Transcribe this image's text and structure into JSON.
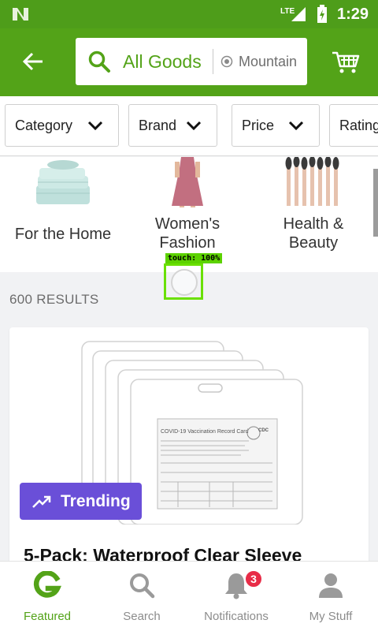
{
  "status_bar": {
    "network": "LTE",
    "time": "1:29"
  },
  "app_bar": {
    "search_query": "All Goods",
    "location": "Mountain"
  },
  "filters": [
    {
      "label": "Category"
    },
    {
      "label": "Brand"
    },
    {
      "label": "Price"
    },
    {
      "label": "Rating"
    }
  ],
  "categories": [
    {
      "label_line1": "For the Home",
      "label_line2": ""
    },
    {
      "label_line1": "Women's",
      "label_line2": "Fashion"
    },
    {
      "label_line1": "Health &",
      "label_line2": "Beauty"
    }
  ],
  "touch_overlay": {
    "label": "touch: 100%"
  },
  "results": {
    "count_text": "600 RESULTS"
  },
  "product": {
    "badge": "Trending",
    "title": "5-Pack: Waterproof Clear Sleeve",
    "image_card_title": "COVID-19 Vaccination Record Card",
    "image_card_logo": "CDC"
  },
  "bottom_nav": [
    {
      "label": "Featured",
      "icon": "featured-g-icon",
      "active": true
    },
    {
      "label": "Search",
      "icon": "search-icon"
    },
    {
      "label": "Notifications",
      "icon": "bell-icon",
      "badge": "3"
    },
    {
      "label": "My Stuff",
      "icon": "person-icon"
    }
  ],
  "colors": {
    "brand_green": "#53a318",
    "trending_purple": "#6a4fd8",
    "badge_red": "#e82c47"
  }
}
